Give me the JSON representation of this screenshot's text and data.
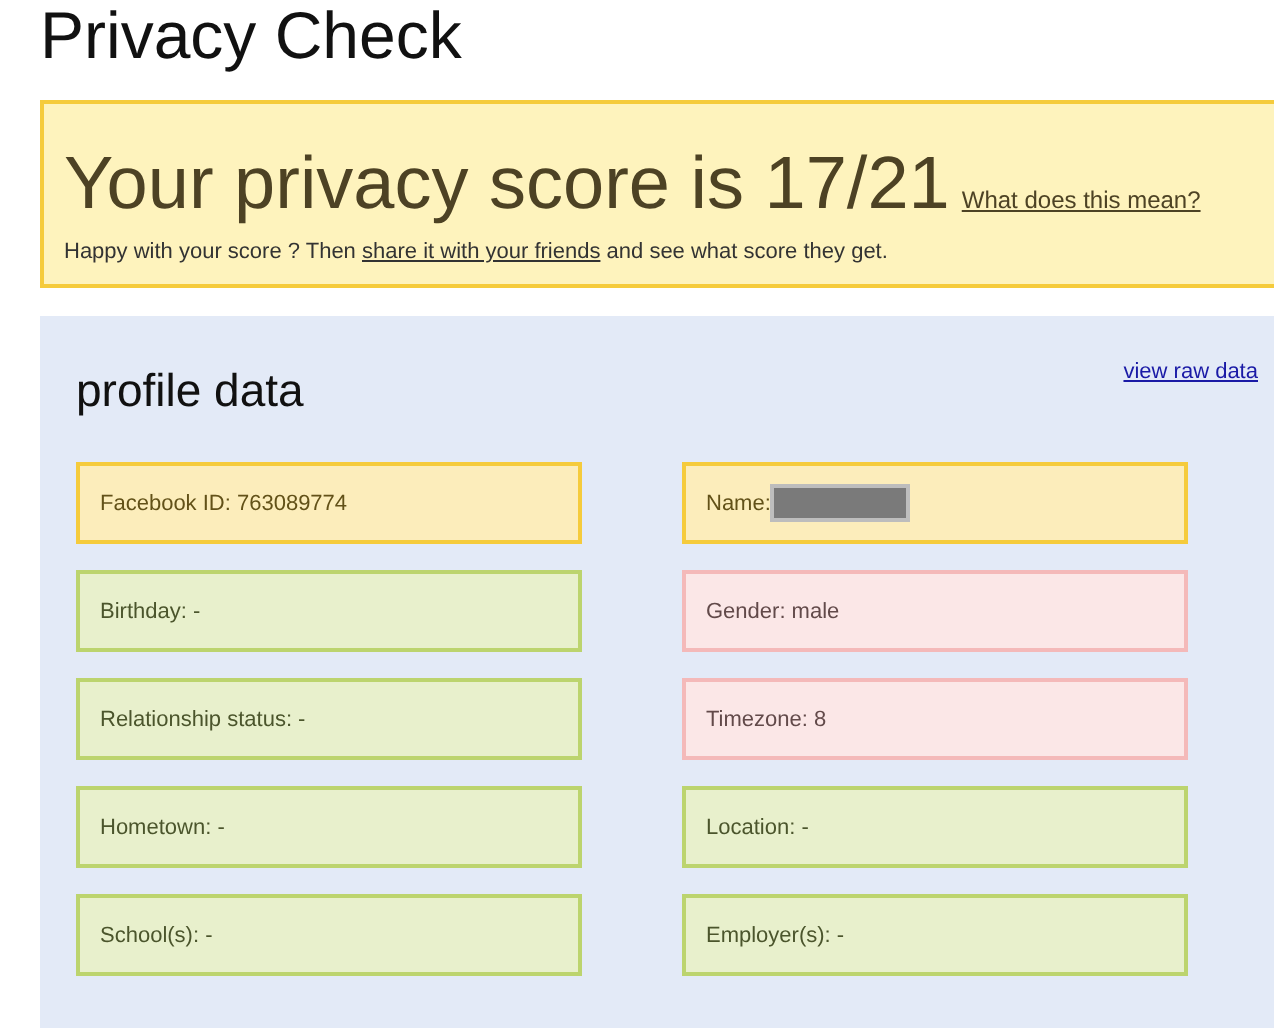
{
  "page": {
    "title": "Privacy Check"
  },
  "score_box": {
    "heading": "Your privacy score is 17/21",
    "help_link": "What does this mean?",
    "message": {
      "before": "Happy with your score ? Then",
      "link": "share it with your friends",
      "after": "and see what score they get."
    }
  },
  "profile": {
    "title": "profile data",
    "raw_link": "view raw data",
    "fields": [
      {
        "text": "Facebook ID: 763089774",
        "color": "#f5cb3c"
      },
      {
        "text": "Name:",
        "color": "#f5cb3c",
        "redacted": true
      },
      {
        "text": "Birthday: -",
        "color": "#bcd46e"
      },
      {
        "text": "Gender: male",
        "color": "#f4b9b9"
      },
      {
        "text": "Relationship status: -",
        "color": "#bcd46e"
      },
      {
        "text": "Timezone: 8",
        "color": "#f4b9b9"
      },
      {
        "text": "Hometown: -",
        "color": "#bcd46e"
      },
      {
        "text": "Location: -",
        "color": "#bcd46e"
      },
      {
        "text": "School(s): -",
        "color": "#bcd46e"
      },
      {
        "text": "Employer(s): -",
        "color": "#bcd46e"
      }
    ]
  }
}
